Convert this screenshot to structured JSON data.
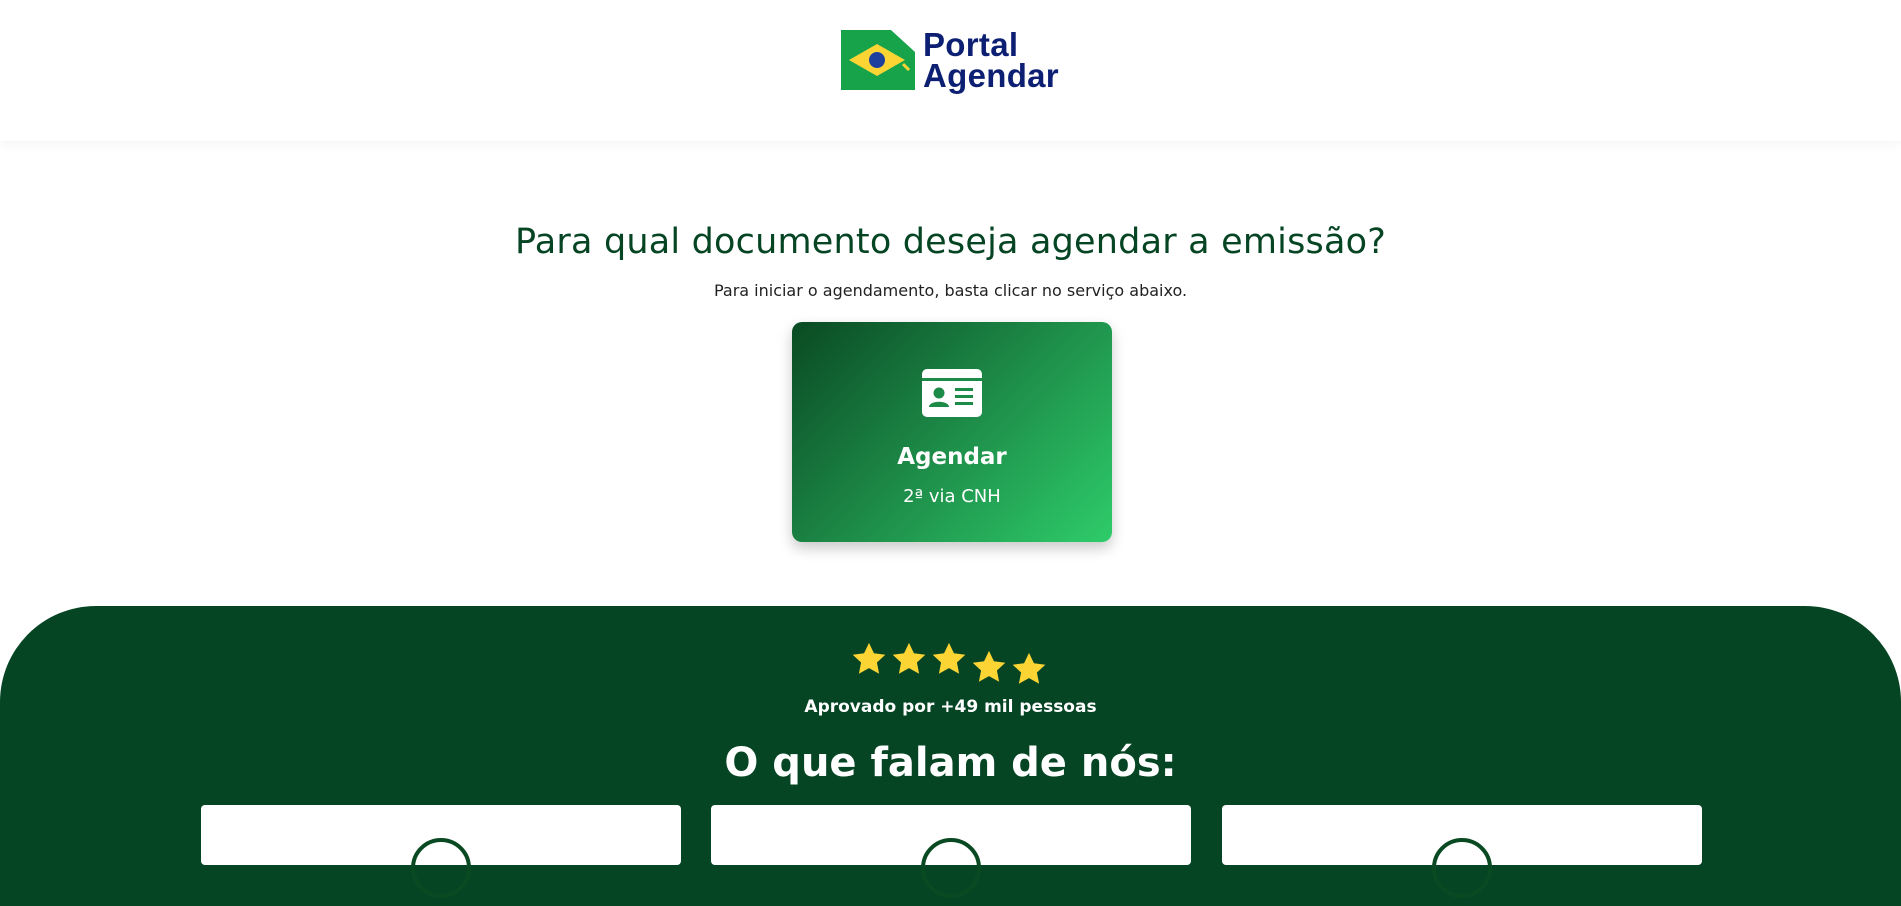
{
  "header": {
    "logo_line1": "Portal",
    "logo_line2": "Agendar"
  },
  "main": {
    "title": "Para qual documento deseja agendar a emissão?",
    "subtitle": "Para iniciar o agendamento, basta clicar no serviço abaixo.",
    "service_card": {
      "icon": "id-card-icon",
      "title": "Agendar",
      "subtitle": "2ª via CNH"
    }
  },
  "testimonials": {
    "rating_stars": 5,
    "approved_text": "Aprovado por +49 mil pessoas",
    "section_title": "O que falam de nós:"
  },
  "colors": {
    "brand_green_dark": "#064524",
    "brand_green_light": "#2ecc6a",
    "brand_navy": "#0c1f73",
    "star_yellow": "#fcd535"
  }
}
